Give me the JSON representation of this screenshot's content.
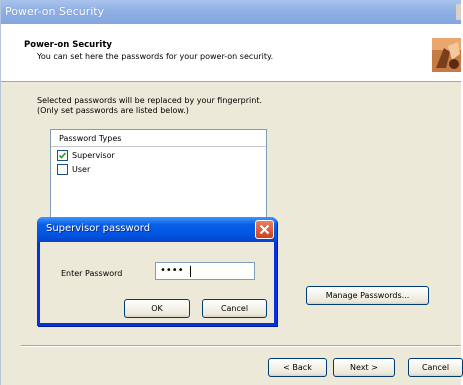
{
  "window": {
    "title": "Power-on Security"
  },
  "header": {
    "title": "Power-on Security",
    "subtitle": "You can set here the passwords for your power-on security."
  },
  "intro": {
    "line1": "Selected passwords will be replaced by your fingerprint.",
    "line2": "(Only set passwords are listed below.)"
  },
  "password_types": {
    "header": "Password Types",
    "items": [
      {
        "label": "Supervisor",
        "checked": true
      },
      {
        "label": "User",
        "checked": false
      }
    ]
  },
  "manage_button": "Manage Passwords...",
  "dialog": {
    "title": "Supervisor password",
    "field_label": "Enter Password",
    "field_value": "••••",
    "ok": "OK",
    "cancel": "Cancel"
  },
  "footer": {
    "back": "< Back",
    "next": "Next >",
    "cancel": "Cancel"
  },
  "colors": {
    "title_accent": "#0054e3",
    "close": "#d0421c"
  }
}
